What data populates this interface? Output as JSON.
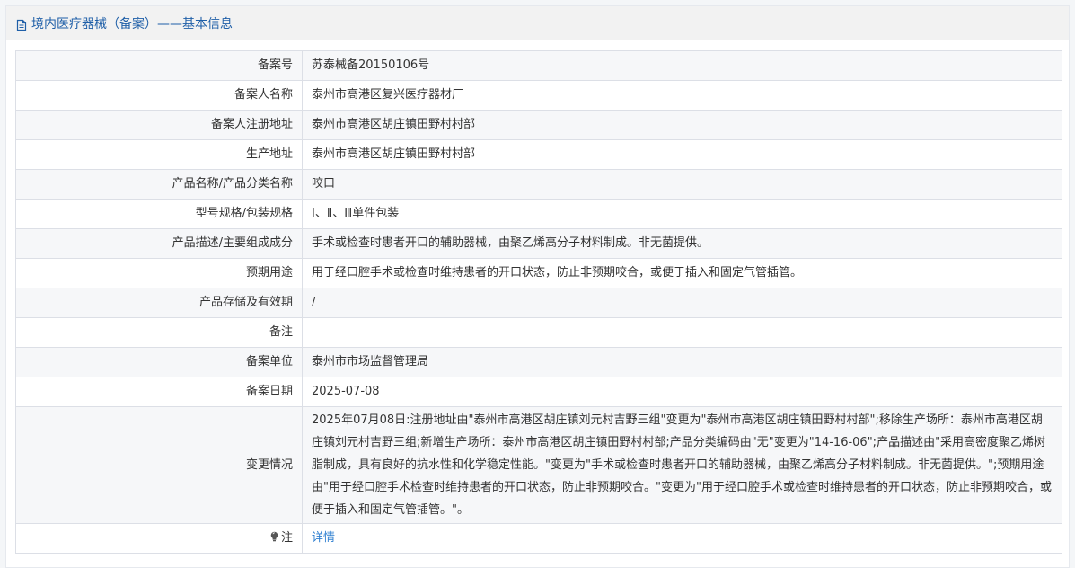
{
  "header": {
    "title": "境内医疗器械（备案）——基本信息",
    "icon": "document-icon",
    "title_color": "#1f5fa8"
  },
  "rows": [
    {
      "label": "备案号",
      "value": "苏泰械备20150106号"
    },
    {
      "label": "备案人名称",
      "value": "泰州市高港区复兴医疗器材厂"
    },
    {
      "label": "备案人注册地址",
      "value": "泰州市高港区胡庄镇田野村村部"
    },
    {
      "label": "生产地址",
      "value": "泰州市高港区胡庄镇田野村村部"
    },
    {
      "label": "产品名称/产品分类名称",
      "value": "咬口"
    },
    {
      "label": "型号规格/包装规格",
      "value": "Ⅰ、Ⅱ、Ⅲ单件包装"
    },
    {
      "label": "产品描述/主要组成成分",
      "value": "手术或检查时患者开口的辅助器械，由聚乙烯高分子材料制成。非无菌提供。"
    },
    {
      "label": "预期用途",
      "value": "用于经口腔手术或检查时维持患者的开口状态，防止非预期咬合，或便于插入和固定气管插管。"
    },
    {
      "label": "产品存储及有效期",
      "value": "/"
    },
    {
      "label": "备注",
      "value": ""
    },
    {
      "label": "备案单位",
      "value": "泰州市市场监督管理局"
    },
    {
      "label": "备案日期",
      "value": "2025-07-08"
    },
    {
      "label": "变更情况",
      "value": "2025年07月08日:注册地址由\"泰州市高港区胡庄镇刘元村吉野三组\"变更为\"泰州市高港区胡庄镇田野村村部\";移除生产场所：泰州市高港区胡庄镇刘元村吉野三组;新增生产场所：泰州市高港区胡庄镇田野村村部;产品分类编码由\"无\"变更为\"14-16-06\";产品描述由\"采用高密度聚乙烯树脂制成，具有良好的抗水性和化学稳定性能。\"变更为\"手术或检查时患者开口的辅助器械，由聚乙烯高分子材料制成。非无菌提供。\";预期用途由\"用于经口腔手术检查时维持患者的开口状态，防止非预期咬合。\"变更为\"用于经口腔手术或检查时维持患者的开口状态，防止非预期咬合，或便于插入和固定气管插管。\"。"
    }
  ],
  "note_row": {
    "label": "注",
    "icon": "lightbulb-icon",
    "link_text": "详情",
    "link_color": "#2f7fd0"
  }
}
